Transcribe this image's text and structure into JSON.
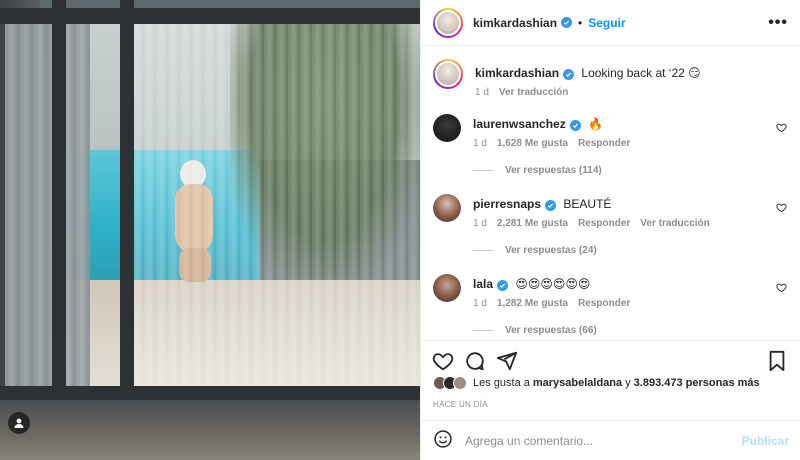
{
  "post": {
    "author": "kimkardashian",
    "follow_label": "Seguir",
    "dot": "•",
    "more": "•••",
    "caption_author": "kimkardashian",
    "caption": "Looking back at ‘22 😏",
    "caption_time": "1 d",
    "caption_translate": "Ver traducción"
  },
  "comments": [
    {
      "user": "laurenwsanchez",
      "text": "🔥",
      "time": "1 d",
      "likes": "1,628 Me gusta",
      "reply": "Responder",
      "translate": "",
      "replies": "Ver respuestas (114)"
    },
    {
      "user": "pierresnaps",
      "text": "BEAUTÉ",
      "time": "1 d",
      "likes": "2,281 Me gusta",
      "reply": "Responder",
      "translate": "Ver traducción",
      "replies": "Ver respuestas (24)"
    },
    {
      "user": "lala",
      "text": "😍😍😍😍😍😍",
      "time": "1 d",
      "likes": "1,282 Me gusta",
      "reply": "Responder",
      "translate": "",
      "replies": "Ver respuestas (66)"
    }
  ],
  "likes": {
    "prefix": "Les gusta a ",
    "user": "marysabelaldana",
    "middle": " y ",
    "count": "3.893.473 personas más"
  },
  "time_ago": "HACE UN DÍA",
  "composer": {
    "placeholder": "Agrega un comentario...",
    "publish": "Publicar"
  },
  "colors": {
    "accent": "#0095f6",
    "verified": "#3897f0",
    "muted": "#8e8e8e",
    "publish_disabled": "#b2dffc"
  }
}
